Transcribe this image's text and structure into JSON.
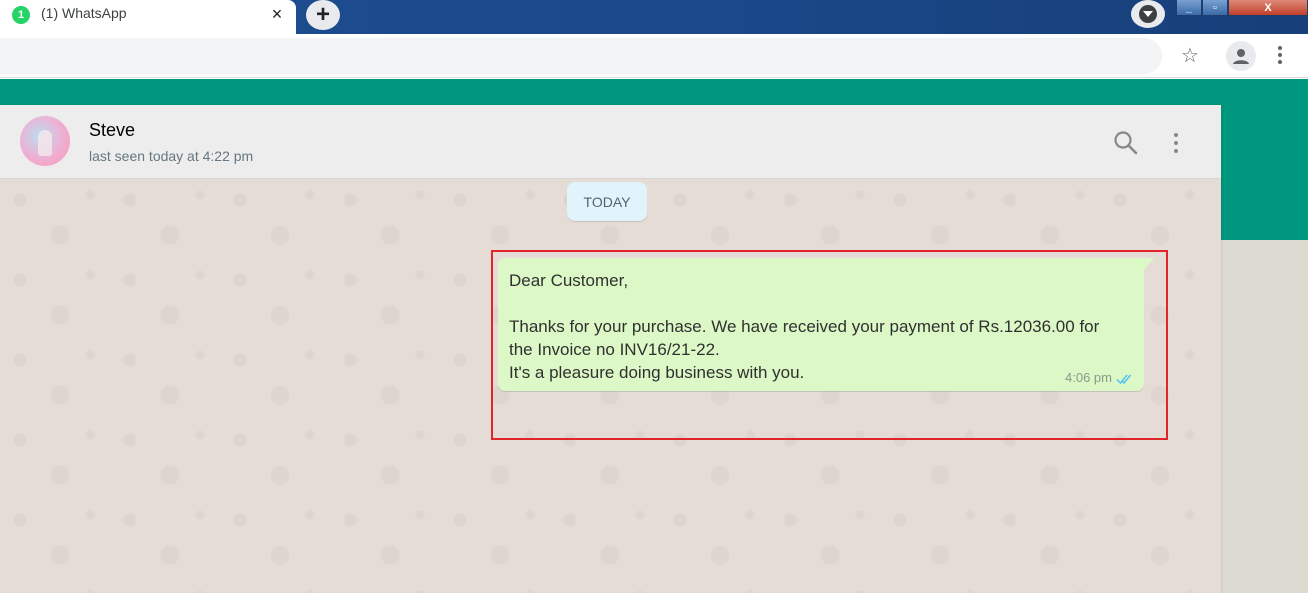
{
  "browser": {
    "tab": {
      "badge": "1",
      "title": "(1) WhatsApp",
      "close": "×"
    },
    "new_tab": "+",
    "window_controls": {
      "minimize": "_",
      "maximize": "▫",
      "close": "X"
    },
    "star": "☆"
  },
  "chat": {
    "contact": {
      "name": "Steve",
      "status": "last seen today at 4:22 pm"
    },
    "date_divider": "TODAY",
    "message": {
      "lines": [
        "Dear Customer,",
        "",
        "Thanks for your purchase. We have received your payment of Rs.12036.00 for",
        "the Invoice no INV16/21-22.",
        "It's a pleasure doing business with you."
      ],
      "time": "4:06 pm",
      "status": "read"
    }
  },
  "colors": {
    "teal": "#00977f",
    "outgoing_bubble": "#dcf8c6",
    "highlight_border": "#e0252b",
    "read_ticks": "#4fc3f7"
  }
}
